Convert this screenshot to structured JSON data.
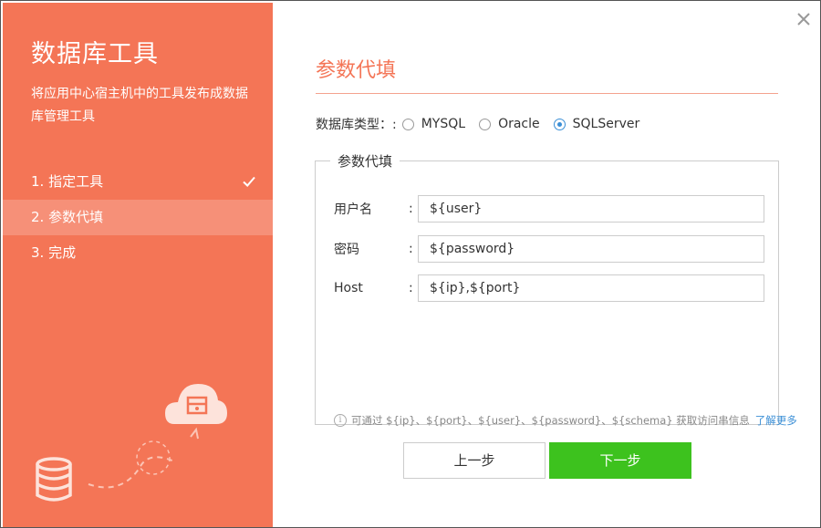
{
  "sidebar": {
    "title": "数据库工具",
    "description": "将应用中心宿主机中的工具发布成数据库管理工具",
    "steps": [
      {
        "label": "1. 指定工具",
        "completed": true
      },
      {
        "label": "2. 参数代填",
        "active": true
      },
      {
        "label": "3. 完成"
      }
    ]
  },
  "main": {
    "section_title": "参数代填",
    "db_type": {
      "label": "数据库类型：:",
      "options": [
        "MYSQL",
        "Oracle",
        "SQLServer"
      ],
      "selected": "SQLServer"
    },
    "params": {
      "legend": "参数代填",
      "fields": [
        {
          "label": "用户名",
          "colon": ":",
          "value": "${user}"
        },
        {
          "label": "密码",
          "colon": ":",
          "value": "${password}"
        },
        {
          "label": "Host",
          "colon": ":",
          "value": "${ip},${port}"
        }
      ],
      "hint_text": "可通过 ${ip}、${port}、${user}、${password}、${schema} 获取访问串信息",
      "hint_link": "了解更多"
    },
    "buttons": {
      "prev_label": "上一步",
      "next_label": "下一步"
    }
  },
  "colors": {
    "accent": "#f47556",
    "active_step": "#f69078",
    "primary_button": "#3dc21e",
    "link": "#3b8fd6"
  }
}
